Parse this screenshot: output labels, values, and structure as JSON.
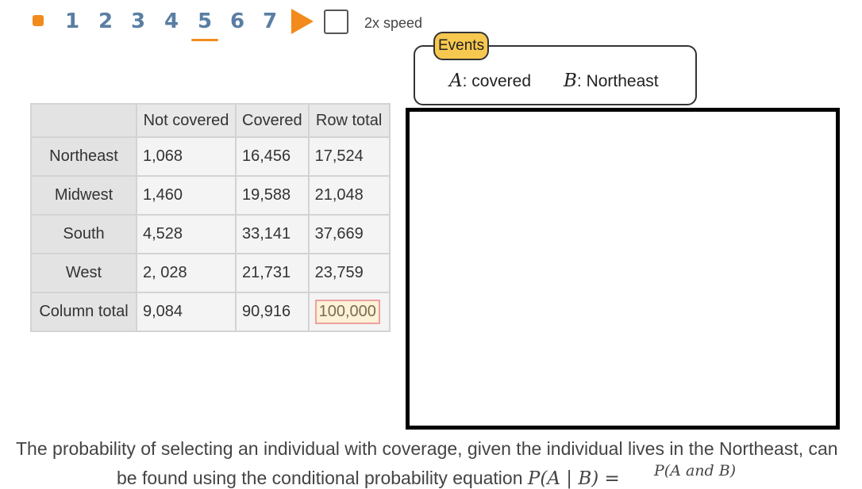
{
  "controls": {
    "steps": [
      "1",
      "2",
      "3",
      "4",
      "5",
      "6",
      "7"
    ],
    "active_step": "5",
    "speed_label": "2x speed",
    "colors": {
      "accent": "#f28a1c",
      "step_text": "#5a7ea3"
    }
  },
  "events": {
    "tag": "Events",
    "a_var": "A",
    "a_label": ": covered",
    "b_var": "B",
    "b_label": ": Northeast",
    "tag_color": "#f7c84f"
  },
  "table": {
    "headers": [
      "",
      "Not covered",
      "Covered",
      "Row total"
    ],
    "rows": [
      {
        "label": "Northeast",
        "values": [
          "1,068",
          "16,456",
          "17,524"
        ]
      },
      {
        "label": "Midwest",
        "values": [
          "1,460",
          "19,588",
          "21,048"
        ]
      },
      {
        "label": "South",
        "values": [
          "4,528",
          "33,141",
          "37,669"
        ]
      },
      {
        "label": "West",
        "values": [
          "2, 028",
          "21,731",
          "23,759"
        ]
      },
      {
        "label": "Column total",
        "values": [
          "9,084",
          "90,916",
          "100,000"
        ]
      }
    ],
    "highlight_color": "#eea0a0"
  },
  "text": {
    "line1": "The probability of selecting an individual with coverage, given the individual lives in the Northeast, can",
    "line2_start": "be found using the conditional probability equation ",
    "line2_eq": "P(A | B) =",
    "fraction_numerator": "P(A and B)"
  }
}
